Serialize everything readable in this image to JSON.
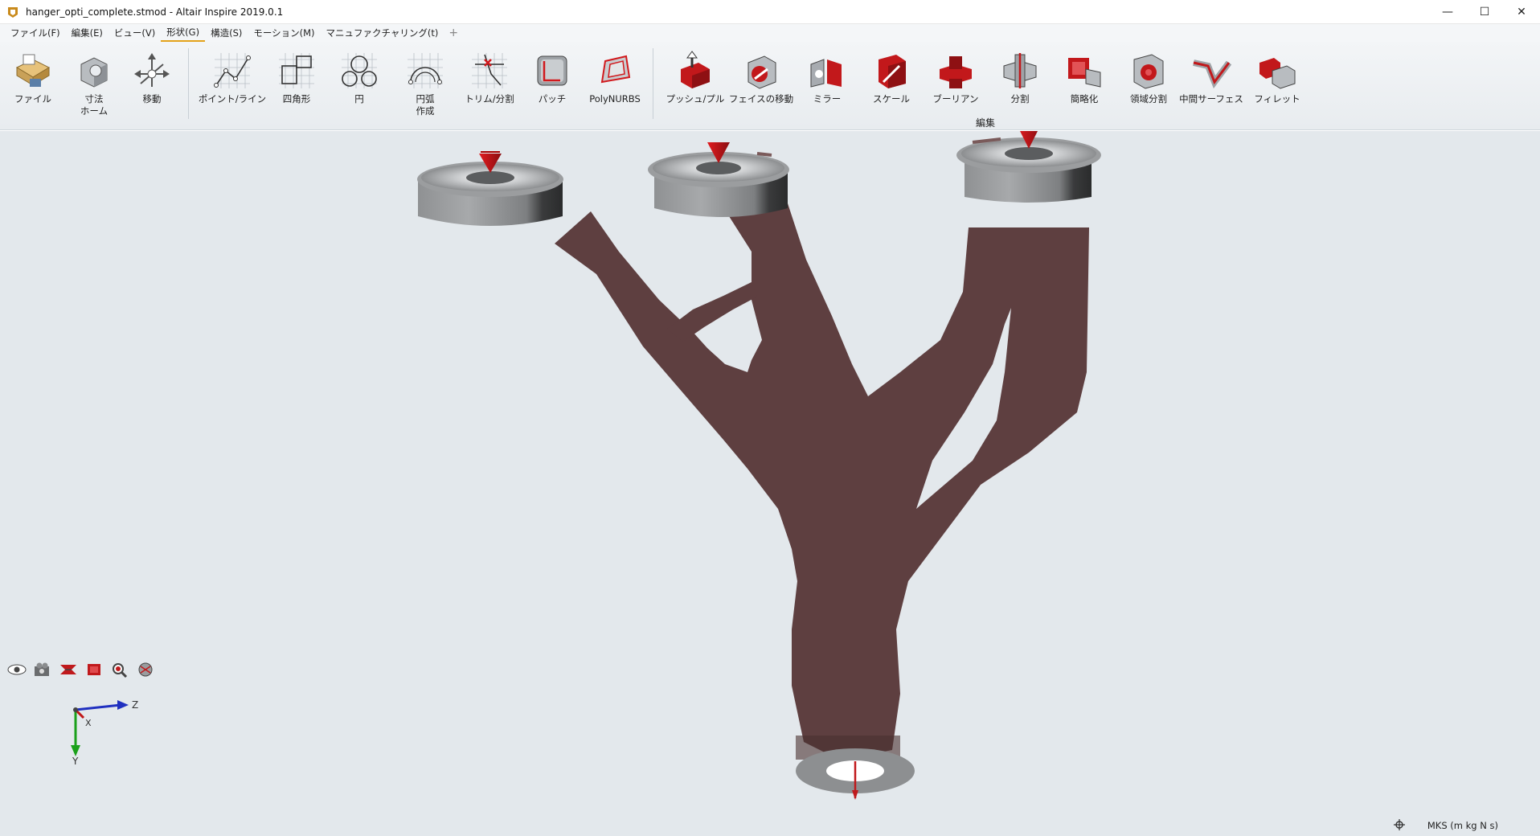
{
  "window": {
    "title": "hanger_opti_complete.stmod - Altair Inspire 2019.0.1",
    "minimize_icon": "minimize-icon",
    "maximize_icon": "maximize-icon",
    "close_icon": "close-icon"
  },
  "menubar": {
    "items": [
      {
        "label": "ファイル(F)"
      },
      {
        "label": "編集(E)"
      },
      {
        "label": "ビュー(V)"
      },
      {
        "label": "形状(G)",
        "active": true
      },
      {
        "label": "構造(S)"
      },
      {
        "label": "モーション(M)"
      },
      {
        "label": "マニュファクチャリング(t)"
      }
    ],
    "add_label": "+"
  },
  "ribbon": {
    "tools": [
      {
        "label": "ファイル",
        "icon": "file-icon"
      },
      {
        "label": "寸法",
        "label2": "ホーム",
        "icon": "dimension-home-icon"
      },
      {
        "label": "移動",
        "icon": "move-icon"
      },
      {
        "label": "ポイント/ライン",
        "icon": "point-line-icon"
      },
      {
        "label": "四角形",
        "icon": "rectangle-icon"
      },
      {
        "label": "円",
        "icon": "circle-icon"
      },
      {
        "label": "円弧",
        "label2": "作成",
        "icon": "arc-create-icon"
      },
      {
        "label": "トリム/分割",
        "icon": "trim-split-icon"
      },
      {
        "label": "パッチ",
        "icon": "patch-icon"
      },
      {
        "label": "PolyNURBS",
        "icon": "polynurbs-icon"
      },
      {
        "label": "プッシュ/プル",
        "icon": "push-pull-icon"
      },
      {
        "label": "フェイスの移動",
        "icon": "move-face-icon"
      },
      {
        "label": "ミラー",
        "icon": "mirror-icon"
      },
      {
        "label": "スケール",
        "icon": "scale-icon"
      },
      {
        "label": "ブーリアン",
        "icon": "boolean-icon"
      },
      {
        "label": "分割",
        "icon": "split-icon"
      },
      {
        "label": "簡略化",
        "icon": "simplify-icon"
      },
      {
        "label": "領域分割",
        "icon": "partition-icon"
      },
      {
        "label": "中間サーフェス",
        "icon": "midsurface-icon"
      },
      {
        "label": "フィレット",
        "icon": "fillet-icon"
      }
    ],
    "edit_group_label": "編集"
  },
  "viewport": {
    "triad": {
      "z": "Z",
      "x": "X",
      "y": "Y"
    },
    "part_color": "#5e3f40",
    "disk_color": "#8d8f91",
    "force_color": "#c0191c"
  },
  "view_tools": [
    "visibility-eye-icon",
    "camera-icon",
    "section-icon",
    "box-select-icon",
    "zoom-icon",
    "render-mode-icon"
  ],
  "status": {
    "snap_icon": "snap-icon",
    "units": "MKS (m kg N s)"
  }
}
